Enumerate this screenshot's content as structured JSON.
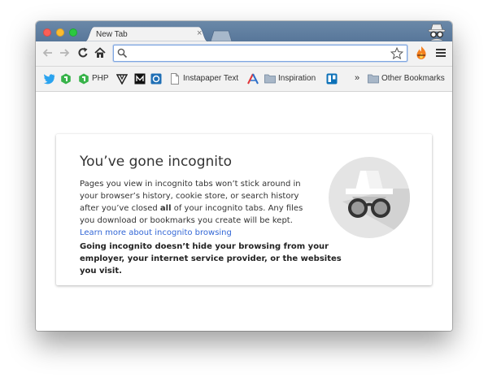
{
  "tab": {
    "title": "New Tab",
    "close": "×"
  },
  "omnibox": {
    "value": "",
    "placeholder": ""
  },
  "bookmarks": {
    "php": "PHP",
    "instapaper": "Instapaper Text",
    "inspiration": "Inspiration",
    "overflow": "»",
    "other": "Other Bookmarks"
  },
  "page": {
    "title": "You’ve gone incognito",
    "para_1": "Pages you view in incognito tabs won’t stick around in your browser’s history, cookie store, or search history after you’ve closed ",
    "para_bold": "all",
    "para_2": " of your incognito tabs. Any files you download or bookmarks you create will be kept. ",
    "learn_more": "Learn more about incognito browsing",
    "warning": "Going incognito doesn’t hide your browsing from your employer, your internet service provider, or the websites you visit."
  },
  "icons": {
    "back": "back-arrow-icon",
    "forward": "forward-arrow-icon",
    "reload": "reload-icon",
    "home": "home-icon",
    "search": "search-icon",
    "star": "star-icon",
    "extension": "flame-extension-icon",
    "menu": "hamburger-menu-icon"
  },
  "colors": {
    "link": "#3367d6",
    "titlebar": "#5f7fa1"
  }
}
